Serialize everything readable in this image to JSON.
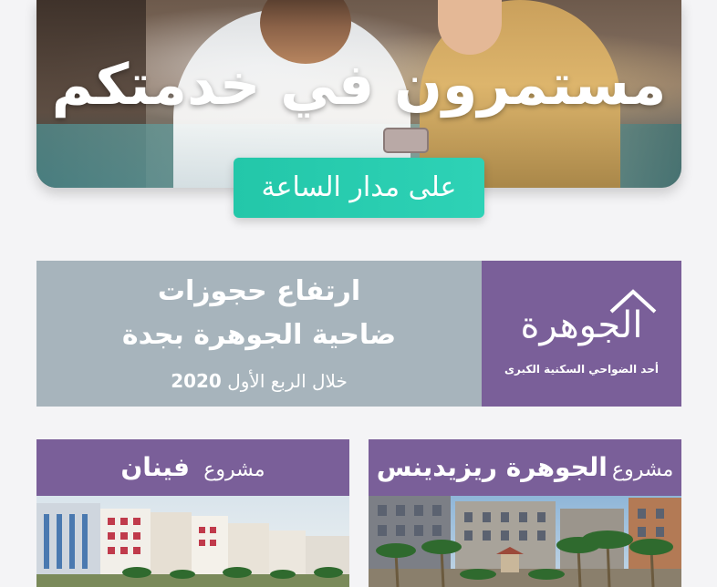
{
  "hero": {
    "title": "مستمرون في خدمتكم",
    "badge": "على مدار الساعة"
  },
  "info_banner": {
    "headline_line1": "ارتفاع حجوزات",
    "headline_line2": "ضاحية الجوهرة بجدة",
    "subline": "خلال الربع الأول",
    "year": "2020"
  },
  "logo": {
    "name": "الجوهرة",
    "tagline": "أحد الضواحي السكنية الكبرى"
  },
  "projects": [
    {
      "prefix": "مشروع",
      "name": "فينان"
    },
    {
      "prefix": "مشروع",
      "name": "الجوهرة ريزيدينس"
    }
  ],
  "colors": {
    "purple": "#7a5f99",
    "teal": "#2ed2b6",
    "grey_blue": "#a7b4bc",
    "background": "#f4f4f6"
  }
}
